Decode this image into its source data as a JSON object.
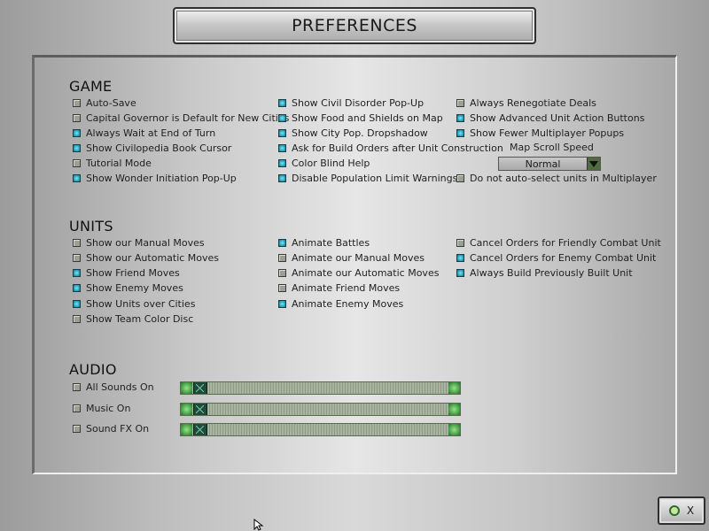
{
  "title": "PREFERENCES",
  "sections": {
    "game": "GAME",
    "units": "UNITS",
    "audio": "AUDIO"
  },
  "game": {
    "col1": [
      {
        "label": "Auto-Save",
        "checked": false
      },
      {
        "label": "Capital Governor is Default for New Cities",
        "checked": false
      },
      {
        "label": "Always Wait at End of Turn",
        "checked": true
      },
      {
        "label": "Show Civilopedia Book Cursor",
        "checked": true
      },
      {
        "label": "Tutorial Mode",
        "checked": false
      },
      {
        "label": "Show Wonder Initiation Pop-Up",
        "checked": true
      }
    ],
    "col2": [
      {
        "label": "Show Civil Disorder Pop-Up",
        "checked": true
      },
      {
        "label": "Show Food and Shields on Map",
        "checked": true
      },
      {
        "label": "Show City Pop. Dropshadow",
        "checked": true
      },
      {
        "label": "Ask for Build Orders after Unit Construction",
        "checked": true
      },
      {
        "label": "Color Blind Help",
        "checked": true
      },
      {
        "label": "Disable Population Limit Warnings",
        "checked": true
      }
    ],
    "col3": [
      {
        "label": "Always Renegotiate Deals",
        "checked": false
      },
      {
        "label": "Show Advanced Unit Action Buttons",
        "checked": true
      },
      {
        "label": "Show Fewer Multiplayer Popups",
        "checked": true
      }
    ],
    "col3_last": {
      "label": "Do not auto-select units in Multiplayer",
      "checked": false
    },
    "map_scroll_label": "Map Scroll Speed",
    "map_scroll_value": "Normal"
  },
  "units": {
    "col1": [
      {
        "label": "Show our Manual Moves",
        "checked": false
      },
      {
        "label": "Show our Automatic Moves",
        "checked": false
      },
      {
        "label": "Show Friend Moves",
        "checked": true
      },
      {
        "label": "Show Enemy Moves",
        "checked": true
      },
      {
        "label": "Show Units over Cities",
        "checked": true
      },
      {
        "label": "Show Team Color Disc",
        "checked": false
      }
    ],
    "col2": [
      {
        "label": "Animate Battles",
        "checked": true
      },
      {
        "label": "Animate our Manual Moves",
        "checked": false
      },
      {
        "label": "Animate our Automatic Moves",
        "checked": false
      },
      {
        "label": "Animate Friend Moves",
        "checked": false
      },
      {
        "label": "Animate Enemy Moves",
        "checked": true
      }
    ],
    "col3": [
      {
        "label": "Cancel Orders for Friendly Combat Unit",
        "checked": false
      },
      {
        "label": "Cancel Orders for Enemy Combat Unit",
        "checked": true
      },
      {
        "label": "Always Build Previously Built Unit",
        "checked": true
      }
    ]
  },
  "audio": [
    {
      "label": "All Sounds On",
      "checked": false,
      "level": 0
    },
    {
      "label": "Music On",
      "checked": false,
      "level": 0
    },
    {
      "label": "Sound FX On",
      "checked": false,
      "level": 0
    }
  ],
  "ok_label": "X",
  "icons": {
    "ok": "ok-circle-icon",
    "close": "close-icon",
    "dropdown": "chevron-down-icon"
  }
}
